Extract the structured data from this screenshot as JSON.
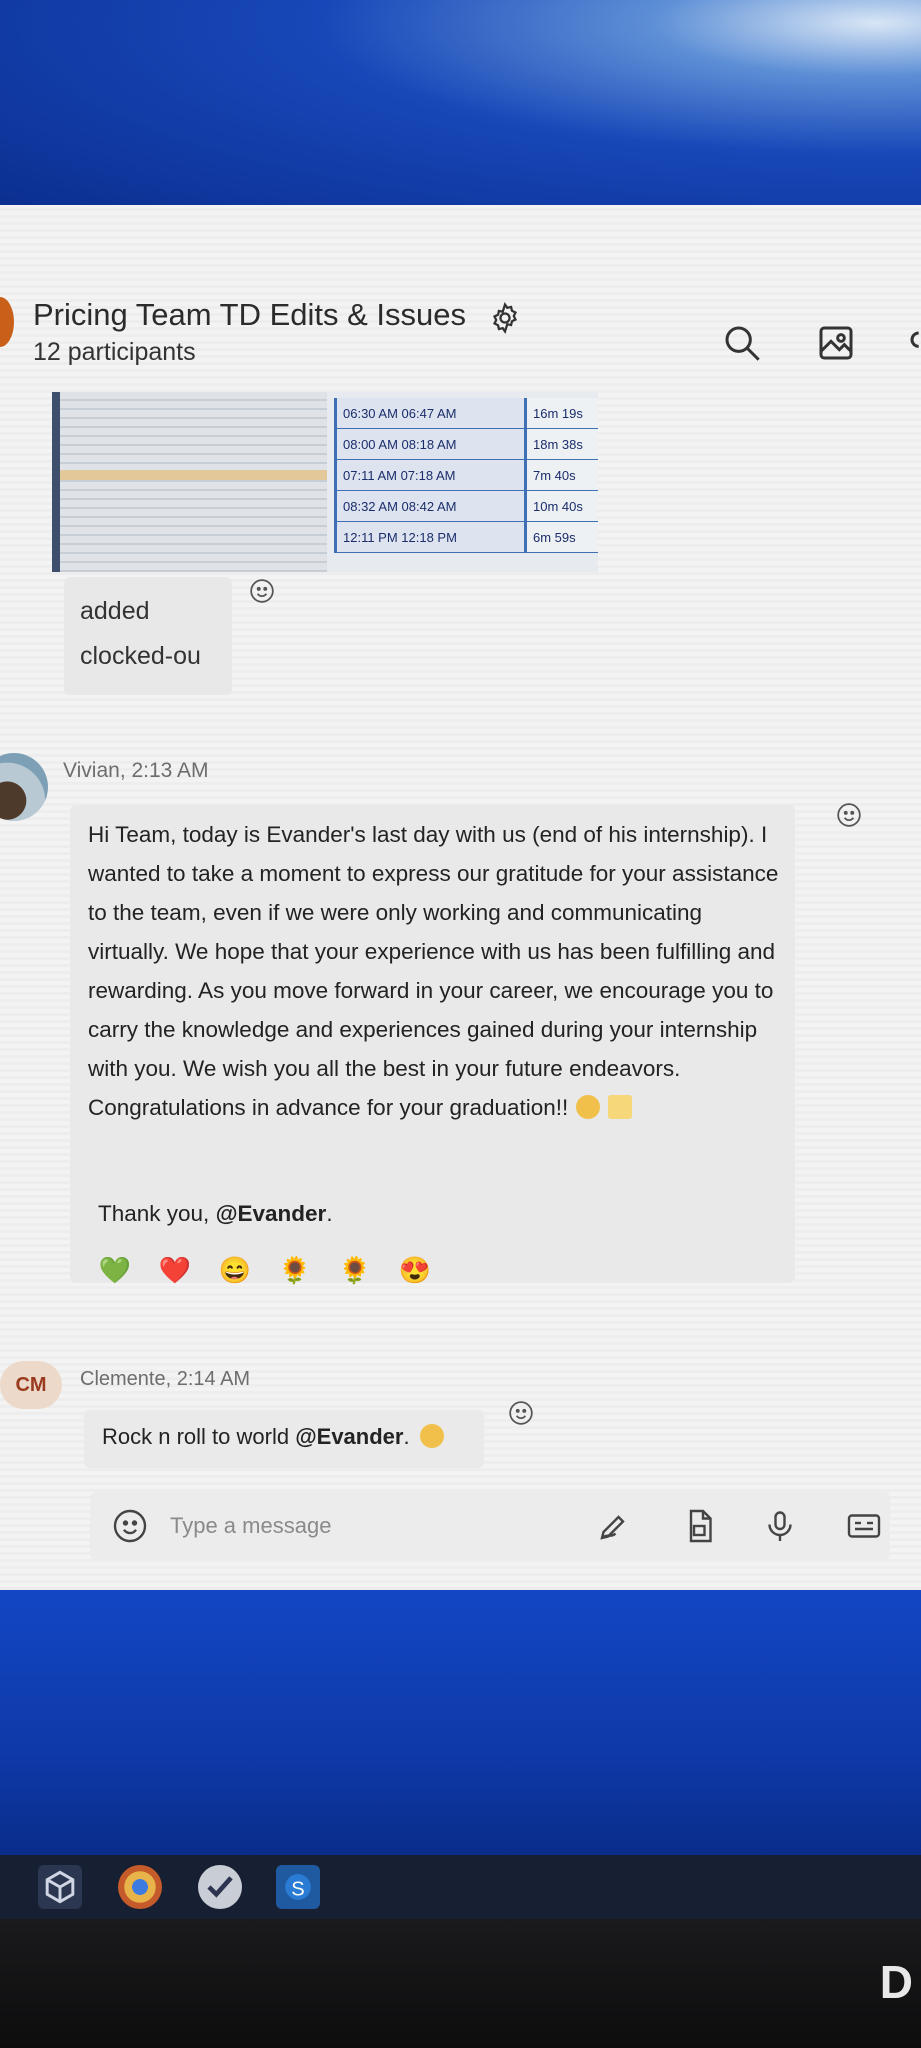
{
  "header": {
    "title": "Pricing Team TD Edits & Issues",
    "participants": "12 participants"
  },
  "thumbnail": {
    "rows": [
      {
        "times": "06:30 AM 06:47 AM",
        "duration": "16m 19s"
      },
      {
        "times": "08:00 AM 08:18 AM",
        "duration": "18m 38s"
      },
      {
        "times": "07:11 AM 07:18 AM",
        "duration": "7m 40s"
      },
      {
        "times": "08:32 AM 08:42 AM",
        "duration": "10m 40s"
      },
      {
        "times": "12:11 PM 12:18 PM",
        "duration": "6m 59s"
      }
    ]
  },
  "messages": {
    "first": {
      "line1": "added",
      "line2": "clocked-ou"
    },
    "vivian": {
      "sender": "Vivian, 2:13 AM",
      "body": "Hi Team, today is Evander's last day with us (end of his internship). I wanted to take a moment to express our gratitude for your assistance to the team, even if we were only working and communicating virtually. We hope that your experience with us has been fulfilling and rewarding. As you move forward in your career, we encourage you to carry the knowledge and experiences gained during your internship with you. We wish you all the best in your future endeavors. Congratulations in advance for your graduation!!",
      "thanks_prefix": "Thank you, ",
      "thanks_mention": "@Evander",
      "thanks_suffix": ".",
      "reactions": [
        "💚",
        "❤️",
        "😄",
        "🌻",
        "🌻",
        "😍"
      ]
    },
    "clemente": {
      "initials": "CM",
      "sender": "Clemente, 2:14 AM",
      "text_prefix": "Rock n roll to world ",
      "mention": "@Evander",
      "text_suffix": "."
    }
  },
  "composer": {
    "placeholder": "Type a message"
  },
  "icons": {
    "header": [
      "gear-icon",
      "search-icon",
      "image-icon"
    ],
    "composer": [
      "emoji-icon",
      "pen-icon",
      "file-icon",
      "microphone-icon",
      "keyboard-icon"
    ]
  },
  "brand": "D"
}
